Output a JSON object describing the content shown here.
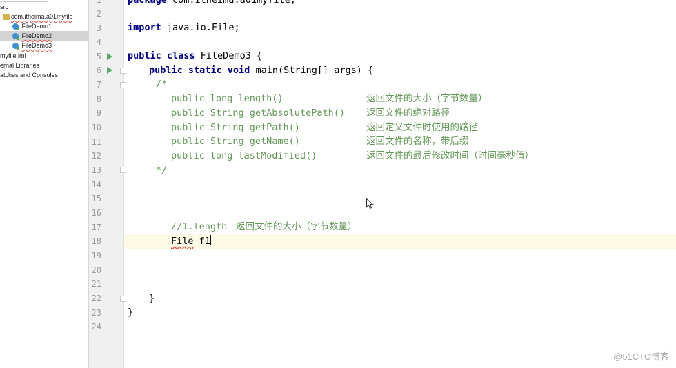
{
  "project_tree": {
    "items": [
      {
        "label": "src",
        "kind": "folder",
        "squiggle": false
      },
      {
        "label": "com.itheima.a01myfile",
        "kind": "package",
        "squiggle": true
      },
      {
        "label": "FileDemo1",
        "kind": "class",
        "squiggle": false
      },
      {
        "label": "FileDemo2",
        "kind": "class",
        "squiggle": true,
        "selected": true
      },
      {
        "label": "FileDemo3",
        "kind": "class",
        "squiggle": true
      },
      {
        "label": "myfile.iml",
        "kind": "file",
        "squiggle": false
      },
      {
        "label": "ernal Libraries",
        "kind": "libraries",
        "squiggle": false
      },
      {
        "label": "atches and Consoles",
        "kind": "scratches",
        "squiggle": false
      }
    ]
  },
  "gutter": {
    "line_numbers": [
      "1",
      "2",
      "3",
      "4",
      "5",
      "6",
      "7",
      "8",
      "9",
      "10",
      "11",
      "12",
      "13",
      "14",
      "15",
      "16",
      "17",
      "18",
      "19",
      "20",
      "21",
      "22",
      "23",
      "24"
    ],
    "run_icons_lines": [
      "5",
      "6"
    ]
  },
  "editor": {
    "current_line": "18",
    "lines": {
      "l1": {
        "kw": "package",
        "rest": " com.itheima.a01myfile;"
      },
      "l3": {
        "kw": "import",
        "rest": " java.io.File;"
      },
      "l5": {
        "kw": "public class",
        "rest": " FileDemo3 {"
      },
      "l6": {
        "kw": "public static void",
        "rest": " main(String[] args) {"
      },
      "l7": {
        "comment": "/*"
      },
      "l8": {
        "code": "public long length()",
        "cn": "返回文件的大小（字节数量）"
      },
      "l9": {
        "code": "public String getAbsolutePath()",
        "cn": "返回文件的绝对路径"
      },
      "l10": {
        "code": "public String getPath()",
        "cn": "返回定义文件时使用的路径"
      },
      "l11": {
        "code": "public String getName()",
        "cn": "返回文件的名称，带后缀"
      },
      "l12": {
        "code": "public long lastModified()",
        "cn": "返回文件的最后修改时间（时间毫秒值）"
      },
      "l13": {
        "comment": "*/"
      },
      "l17": {
        "comment": "//1.length",
        "cn": "返回文件的大小（字节数量）"
      },
      "l18": {
        "type": "File",
        "var": "f1"
      },
      "l22": {
        "code": "}"
      },
      "l23": {
        "code": "}"
      }
    }
  },
  "watermark": "@51CTO博客",
  "colors": {
    "keyword": "#000080",
    "comment": "#629755",
    "gutter_bg": "#f0f0f0",
    "current_line_bg": "#fcfae4",
    "run_icon": "#59a869"
  }
}
